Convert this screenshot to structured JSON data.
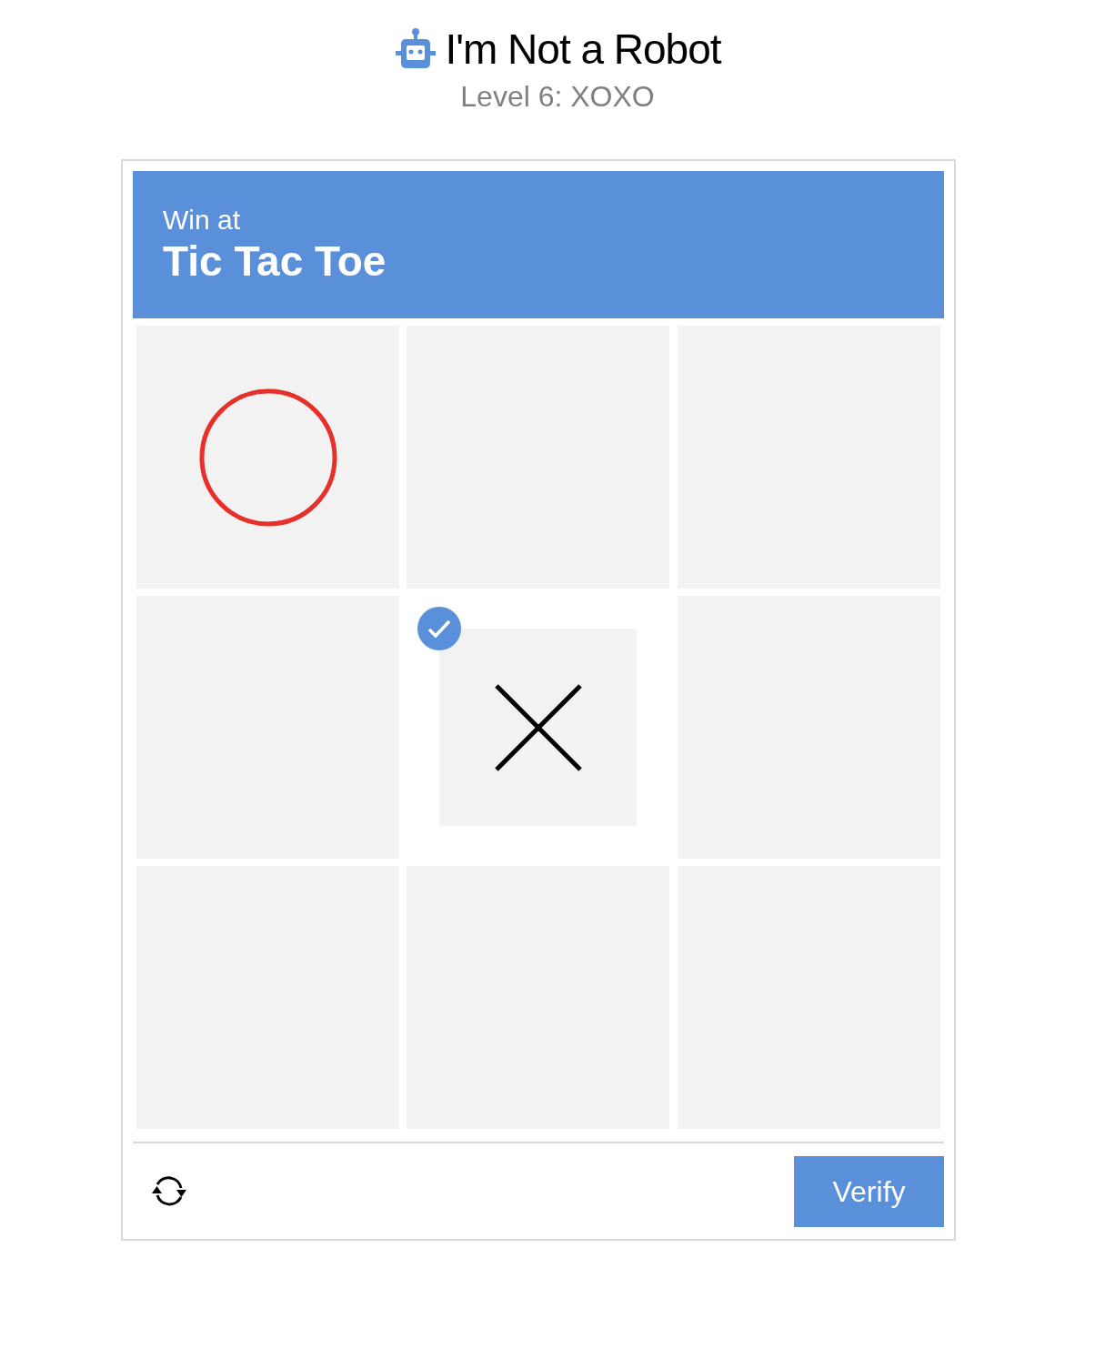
{
  "title": "I'm Not a Robot",
  "subtitle": "Level 6: XOXO",
  "challenge": {
    "prompt": "Win at",
    "game": "Tic Tac Toe"
  },
  "cells": [
    {
      "kind": "o",
      "selected": false
    },
    {
      "kind": "empty",
      "selected": false
    },
    {
      "kind": "empty",
      "selected": false
    },
    {
      "kind": "empty",
      "selected": false
    },
    {
      "kind": "x",
      "selected": true
    },
    {
      "kind": "empty",
      "selected": false
    },
    {
      "kind": "empty",
      "selected": false
    },
    {
      "kind": "empty",
      "selected": false
    },
    {
      "kind": "empty",
      "selected": false
    }
  ],
  "verify_button": "Verify"
}
